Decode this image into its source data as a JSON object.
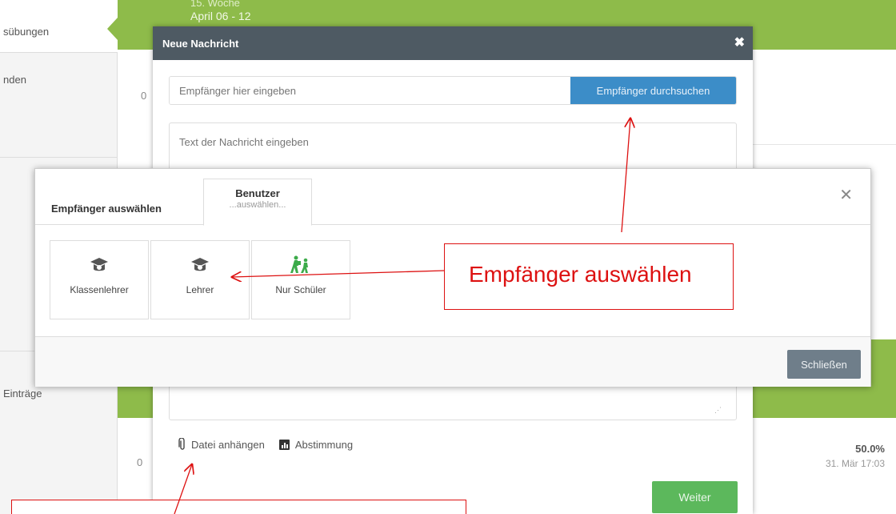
{
  "background": {
    "sidebar": {
      "active_item": "sübungen",
      "item2": "nden",
      "item3": "Einträge"
    },
    "week": {
      "label": "15. Woche",
      "dates": "April 06 - 12"
    },
    "row_marker_1": "0",
    "row_marker_2": "0",
    "progress": {
      "percent": "50.0%",
      "date": "31. Mär 17:03"
    },
    "colors": {
      "green": "#8ebb4a",
      "header_dark": "#4e5a63"
    }
  },
  "message_modal": {
    "title": "Neue Nachricht",
    "close_icon": "close-icon",
    "recipient_placeholder": "Empfänger hier eingeben",
    "search_button": "Empfänger durchsuchen",
    "text_placeholder": "Text der Nachricht eingeben",
    "attach_label": "Datei anhängen",
    "vote_label": "Abstimmung",
    "next_button": "Weiter",
    "colors": {
      "primary": "#3c8dc8",
      "success": "#5cb85c"
    }
  },
  "recipient_modal": {
    "title": "Empfänger auswählen",
    "tab": {
      "title": "Benutzer",
      "subtitle": "...auswählen..."
    },
    "options": [
      {
        "label": "Klassenlehrer",
        "icon": "graduation-cap-icon"
      },
      {
        "label": "Lehrer",
        "icon": "graduation-cap-icon"
      },
      {
        "label": "Nur Schüler",
        "icon": "students-walking-icon"
      }
    ],
    "close_button": "Schließen"
  },
  "annotation": {
    "callout": "Empfänger auswählen",
    "color": "#dd1111"
  }
}
